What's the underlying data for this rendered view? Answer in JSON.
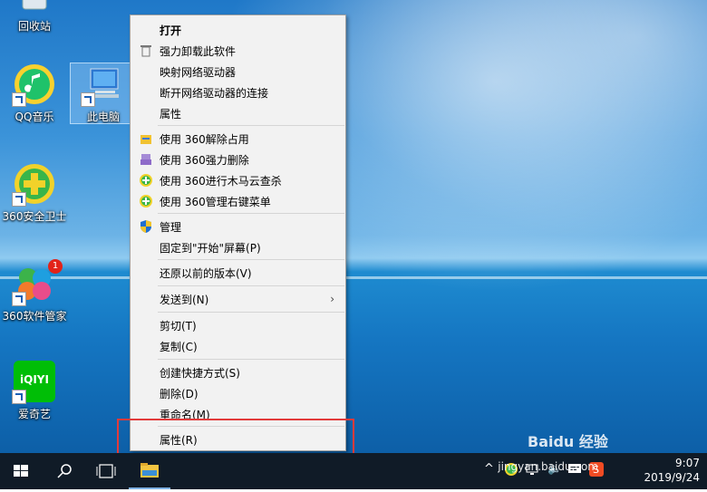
{
  "desktop": {
    "icons": [
      {
        "label": "回收站"
      },
      {
        "label": "QQ音乐"
      },
      {
        "label": "此电脑"
      },
      {
        "label": "360安全卫士"
      },
      {
        "label": "360软件管家",
        "badge": "1"
      },
      {
        "label": "爱奇艺",
        "logo_text": "iQIYI"
      }
    ]
  },
  "menu": {
    "items": [
      {
        "label": "打开"
      },
      {
        "label": "强力卸载此软件"
      },
      {
        "label": "映射网络驱动器"
      },
      {
        "label": "断开网络驱动器的连接"
      },
      {
        "label": "属性"
      },
      {
        "label": "使用 360解除占用"
      },
      {
        "label": "使用 360强力删除"
      },
      {
        "label": "使用 360进行木马云查杀"
      },
      {
        "label": "使用 360管理右键菜单"
      },
      {
        "label": "管理"
      },
      {
        "label": "固定到\"开始\"屏幕(P)"
      },
      {
        "label": "还原以前的版本(V)"
      },
      {
        "label": "发送到(N)"
      },
      {
        "label": "剪切(T)"
      },
      {
        "label": "复制(C)"
      },
      {
        "label": "创建快捷方式(S)"
      },
      {
        "label": "删除(D)"
      },
      {
        "label": "重命名(M)"
      },
      {
        "label": "属性(R)"
      }
    ]
  },
  "taskbar": {
    "time": "9:07",
    "date": "2019/9/24"
  },
  "watermark": {
    "text": "jingyan.baidu.com",
    "logo": "Baidu 经验"
  },
  "colors": {
    "highlight_box": "#e23b3b",
    "taskbar": "#101b27"
  }
}
